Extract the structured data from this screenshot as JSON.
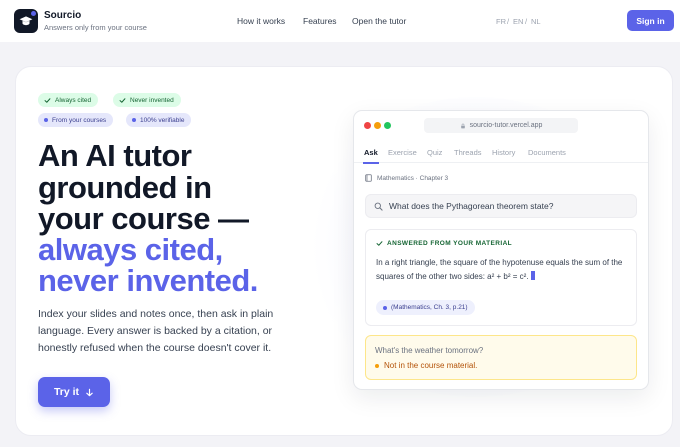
{
  "header": {
    "brand": "Sourcio",
    "tagline": "Answers only from your course",
    "nav": [
      "How it works",
      "Features",
      "Open the tutor"
    ],
    "languages": [
      "FR",
      "EN",
      "NL"
    ],
    "active_language": "EN",
    "signin_label": "Sign in"
  },
  "hero": {
    "badges_row1": [
      "Always cited",
      "Never invented"
    ],
    "badges_row2": [
      "From your courses",
      "100% verifiable"
    ],
    "headline_dark": [
      "An AI tutor",
      "grounded in",
      "your course —"
    ],
    "headline_accent": [
      "always cited,",
      "never invented."
    ],
    "subtitle": "Index your slides and notes once, then ask in plain language. Every answer is backed by a citation, or honestly refused when the course doesn't cover it.",
    "cta_label": "Try it"
  },
  "demo": {
    "url": "sourcio-tutor.vercel.app",
    "tabs": [
      "Ask",
      "Exercise",
      "Quiz",
      "Threads",
      "History",
      "Documents"
    ],
    "active_tab": "Ask",
    "course": "Mathematics · Chapter 3",
    "question": "What does the Pythagorean theorem state?",
    "answer_header": "ANSWERED FROM YOUR MATERIAL",
    "answer_text": "In a right triangle, the square of the hypotenuse equals the sum of the squares of the other two sides: a² + b² = c².",
    "citation": "(Mathematics, Ch. 3, p.21)",
    "refused_question": "What's the weather tomorrow?",
    "refused_answer": "Not in the course material."
  },
  "colors": {
    "accent": "#5b63e8",
    "green": "#166534",
    "amber": "#b45309"
  },
  "icons": [
    "graduation-cap-icon",
    "check-icon",
    "arrow-down-icon",
    "lock-icon",
    "book-icon",
    "search-icon"
  ]
}
